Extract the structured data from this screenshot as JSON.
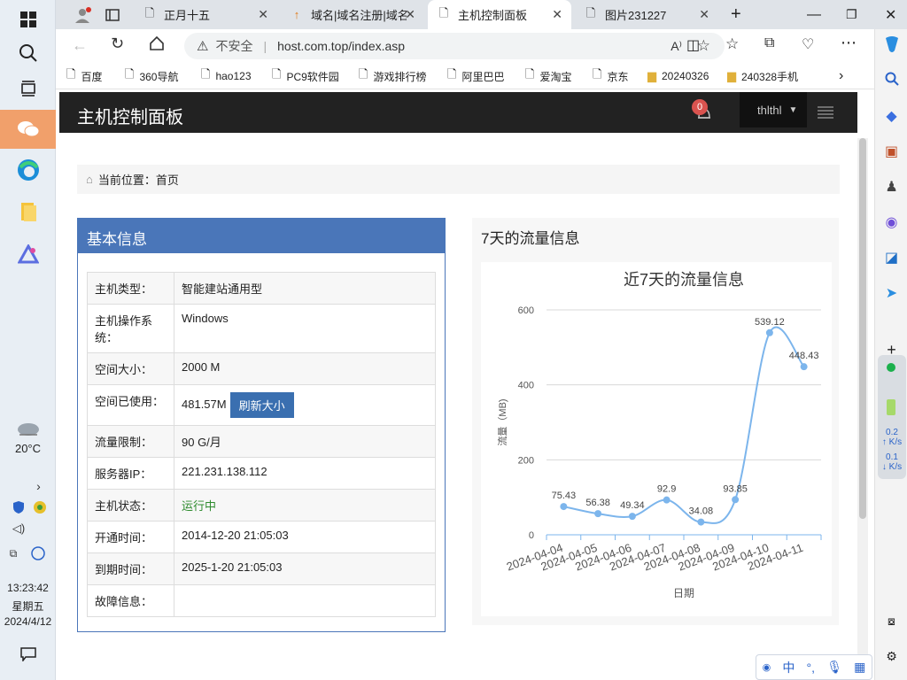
{
  "taskbar": {
    "weather": "20°C",
    "time": "13:23:42",
    "weekday": "星期五",
    "date": "2024/4/12"
  },
  "tabs": [
    {
      "label": "正月十五"
    },
    {
      "label": "域名|域名注册|域名"
    },
    {
      "label": "主机控制面板"
    },
    {
      "label": "图片231227"
    }
  ],
  "toolbar": {
    "insecure_label": "不安全",
    "url": "host.com.top/index.asp"
  },
  "bookmarks": [
    "百度",
    "360导航",
    "hao123",
    "PC9软件园",
    "游戏排行榜",
    "阿里巴巴",
    "爱淘宝",
    "京东",
    "20240326",
    "240328手机"
  ],
  "header": {
    "title": "主机控制面板",
    "notif_count": "0",
    "user": "thlthl"
  },
  "breadcrumb": {
    "label": "当前位置：",
    "current": "首页"
  },
  "basic": {
    "title": "基本信息",
    "rows": [
      {
        "k": "主机类型：",
        "v": "智能建站通用型"
      },
      {
        "k": "主机操作系统：",
        "v": "Windows"
      },
      {
        "k": "空间大小：",
        "v": "2000 M"
      },
      {
        "k": "空间已使用：",
        "v": "481.57M"
      },
      {
        "k": "流量限制：",
        "v": "90 G/月"
      },
      {
        "k": "服务器IP：",
        "v": "221.231.138.112"
      },
      {
        "k": "主机状态：",
        "v": "运行中"
      },
      {
        "k": "开通时间：",
        "v": "2014-12-20 21:05:03"
      },
      {
        "k": "到期时间：",
        "v": "2025-1-20 21:05:03"
      },
      {
        "k": "故障信息：",
        "v": ""
      }
    ],
    "refresh_label": "刷新大小",
    "status_color": "#2e8b2e"
  },
  "traffic": {
    "panel_title": "7天的流量信息"
  },
  "chart_data": {
    "type": "line",
    "title": "近7天的流量信息",
    "xlabel": "日期",
    "ylabel": "流量（MB)",
    "categories": [
      "2024-04-04",
      "2024-04-05",
      "2024-04-06",
      "2024-04-07",
      "2024-04-08",
      "2024-04-09",
      "2024-04-10",
      "2024-04-11"
    ],
    "values": [
      75.43,
      56.38,
      49.34,
      92.9,
      34.08,
      93.85,
      539.12,
      448.43
    ],
    "ylim": [
      0,
      600
    ],
    "yticks": [
      0,
      200,
      400,
      600
    ],
    "grid": true,
    "color": "#7cb5ec"
  },
  "ime": {
    "label": "中"
  }
}
